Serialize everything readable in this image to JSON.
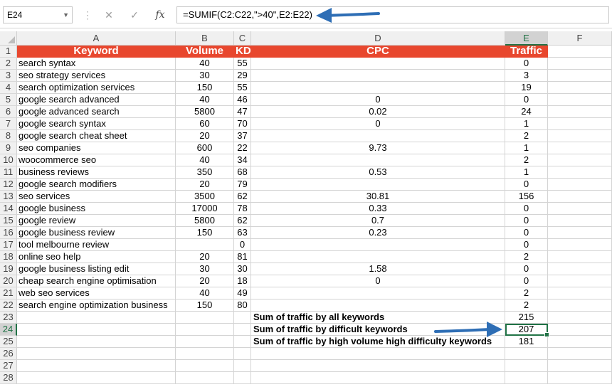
{
  "formula_bar": {
    "name_box": "E24",
    "cancel_icon": "✕",
    "enter_icon": "✓",
    "fx_label": "fx",
    "formula": "=SUMIF(C2:C22,\">40\",E2:E22)"
  },
  "columns": [
    "A",
    "B",
    "C",
    "D",
    "E",
    "F"
  ],
  "row_numbers": [
    "1",
    "2",
    "3",
    "4",
    "5",
    "6",
    "7",
    "8",
    "9",
    "10",
    "11",
    "12",
    "13",
    "14",
    "15",
    "16",
    "17",
    "18",
    "19",
    "20",
    "21",
    "22",
    "23",
    "24",
    "25",
    "26",
    "27",
    "28"
  ],
  "header": {
    "keyword": "Keyword",
    "volume": "Volume",
    "kd": "KD",
    "cpc": "CPC",
    "traffic": "Traffic"
  },
  "rows": [
    {
      "keyword": "search syntax",
      "volume": "40",
      "kd": "55",
      "cpc": "",
      "traffic": "0"
    },
    {
      "keyword": "seo strategy services",
      "volume": "30",
      "kd": "29",
      "cpc": "",
      "traffic": "3"
    },
    {
      "keyword": "search optimization services",
      "volume": "150",
      "kd": "55",
      "cpc": "",
      "traffic": "19"
    },
    {
      "keyword": "google search advanced",
      "volume": "40",
      "kd": "46",
      "cpc": "0",
      "traffic": "0"
    },
    {
      "keyword": "google advanced search",
      "volume": "5800",
      "kd": "47",
      "cpc": "0.02",
      "traffic": "24"
    },
    {
      "keyword": "google search syntax",
      "volume": "60",
      "kd": "70",
      "cpc": "0",
      "traffic": "1"
    },
    {
      "keyword": "google search cheat sheet",
      "volume": "20",
      "kd": "37",
      "cpc": "",
      "traffic": "2"
    },
    {
      "keyword": "seo companies",
      "volume": "600",
      "kd": "22",
      "cpc": "9.73",
      "traffic": "1"
    },
    {
      "keyword": "woocommerce seo",
      "volume": "40",
      "kd": "34",
      "cpc": "",
      "traffic": "2"
    },
    {
      "keyword": "business reviews",
      "volume": "350",
      "kd": "68",
      "cpc": "0.53",
      "traffic": "1"
    },
    {
      "keyword": "google search modifiers",
      "volume": "20",
      "kd": "79",
      "cpc": "",
      "traffic": "0"
    },
    {
      "keyword": "seo services",
      "volume": "3500",
      "kd": "62",
      "cpc": "30.81",
      "traffic": "156"
    },
    {
      "keyword": "google business",
      "volume": "17000",
      "kd": "78",
      "cpc": "0.33",
      "traffic": "0"
    },
    {
      "keyword": "google review",
      "volume": "5800",
      "kd": "62",
      "cpc": "0.7",
      "traffic": "0"
    },
    {
      "keyword": "google business review",
      "volume": "150",
      "kd": "63",
      "cpc": "0.23",
      "traffic": "0"
    },
    {
      "keyword": "tool melbourne review",
      "volume": "",
      "kd": "0",
      "cpc": "",
      "traffic": "0"
    },
    {
      "keyword": "online seo help",
      "volume": "20",
      "kd": "81",
      "cpc": "",
      "traffic": "2"
    },
    {
      "keyword": "google business listing edit",
      "volume": "30",
      "kd": "30",
      "cpc": "1.58",
      "traffic": "0"
    },
    {
      "keyword": "cheap search engine optimisation",
      "volume": "20",
      "kd": "18",
      "cpc": "0",
      "traffic": "0"
    },
    {
      "keyword": "web seo services",
      "volume": "40",
      "kd": "49",
      "cpc": "",
      "traffic": "2"
    },
    {
      "keyword": "search engine optimization business",
      "volume": "150",
      "kd": "80",
      "cpc": "",
      "traffic": "2"
    }
  ],
  "summaries": [
    {
      "label": "Sum of traffic by all keywords",
      "value": "215"
    },
    {
      "label": "Sum of traffic by difficult keywords",
      "value": "207"
    },
    {
      "label": "Sum of traffic by high volume high difficulty keywords",
      "value": "181"
    }
  ],
  "active_cell": "E24",
  "colors": {
    "header_bg": "#e8472e",
    "selection": "#217346",
    "arrow": "#2e6eb5"
  }
}
